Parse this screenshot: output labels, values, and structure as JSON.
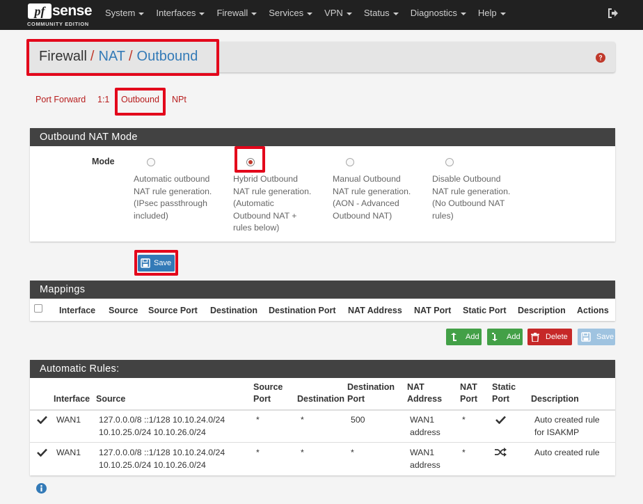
{
  "navbar": {
    "logo_pf": "pf",
    "logo_sense": "sense",
    "logo_edition": "COMMUNITY EDITION",
    "menu": [
      "System",
      "Interfaces",
      "Firewall",
      "Services",
      "VPN",
      "Status",
      "Diagnostics",
      "Help"
    ]
  },
  "breadcrumb": {
    "first": "Firewall",
    "second": "NAT",
    "third": "Outbound",
    "separator": "/"
  },
  "tabs": [
    "Port Forward",
    "1:1",
    "Outbound",
    "NPt"
  ],
  "mode_panel": {
    "title": "Outbound NAT Mode",
    "label": "Mode",
    "selected": 1,
    "options": [
      [
        "Automatic outbound",
        "NAT rule generation.",
        "(IPsec passthrough",
        "included)"
      ],
      [
        "Hybrid Outbound",
        "NAT rule generation.",
        "(Automatic",
        "Outbound NAT +",
        "rules below)"
      ],
      [
        "Manual Outbound",
        "NAT rule generation.",
        "(AON - Advanced",
        "Outbound NAT)"
      ],
      [
        "Disable Outbound",
        "NAT rule generation.",
        "(No Outbound NAT",
        "rules)"
      ]
    ],
    "save_label": "Save"
  },
  "mappings": {
    "title": "Mappings",
    "columns": [
      "Interface",
      "Source",
      "Source Port",
      "Destination",
      "Destination Port",
      "NAT Address",
      "NAT Port",
      "Static Port",
      "Description",
      "Actions"
    ],
    "buttons": [
      "Add",
      "Add",
      "Delete",
      "Save"
    ]
  },
  "auto_rules": {
    "title": "Automatic Rules:",
    "columns": [
      [
        "Interface"
      ],
      [
        "Source"
      ],
      [
        "Source",
        "Port"
      ],
      [
        "Destination"
      ],
      [
        "Destination",
        "Port"
      ],
      [
        "NAT",
        "Address"
      ],
      [
        "NAT",
        "Port"
      ],
      [
        "Static",
        "Port"
      ],
      [
        "Description"
      ]
    ],
    "rows": [
      {
        "status_icon": "check-icon",
        "interface": "WAN1",
        "source": [
          "127.0.0.0/8 ::1/128 10.10.24.0/24",
          "10.10.25.0/24 10.10.26.0/24"
        ],
        "source_port": "*",
        "destination": "*",
        "destination_port": "500",
        "nat_address": [
          "WAN1",
          "address"
        ],
        "nat_port": "*",
        "static_port_icon": "check-icon",
        "description": [
          "Auto created rule",
          "for ISAKMP"
        ]
      },
      {
        "status_icon": "check-icon",
        "interface": "WAN1",
        "source": [
          "127.0.0.0/8 ::1/128 10.10.24.0/24",
          "10.10.25.0/24 10.10.26.0/24"
        ],
        "source_port": "*",
        "destination": "*",
        "destination_port": "*",
        "nat_address": [
          "WAN1",
          "address"
        ],
        "nat_port": "*",
        "static_port_icon": "shuffle-icon",
        "description": [
          "Auto created rule"
        ]
      }
    ]
  },
  "colors": {
    "navbar_bg": "#212121",
    "panel_heading": "#424242",
    "link_red": "#b71c1c",
    "link_blue": "#337ab7",
    "highlight": "#e3061b"
  }
}
